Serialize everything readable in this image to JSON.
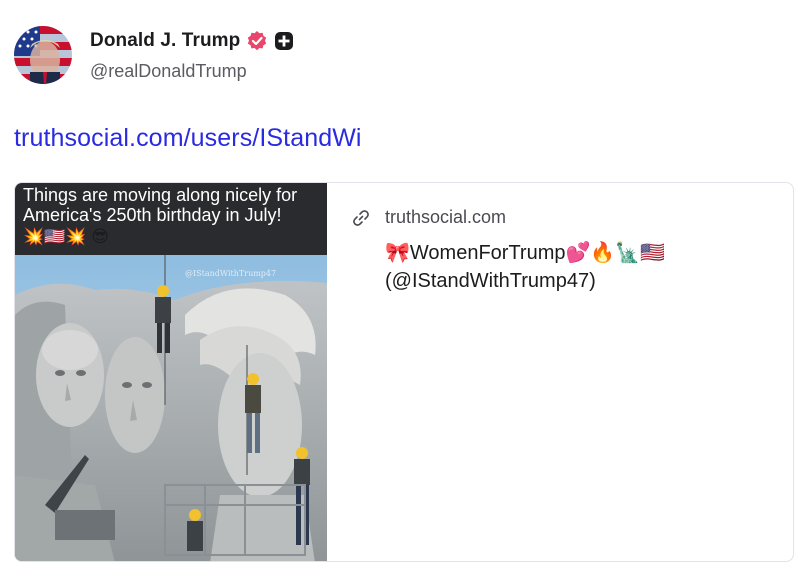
{
  "post": {
    "author": {
      "display_name": "Donald J. Trump",
      "handle": "@realDonaldTrump",
      "verified_icon": "verified-badge-icon",
      "plus_icon": "plus-badge-icon",
      "badge_color": "#e8476b"
    },
    "link_text": "truthsocial.com/users/IStandWi",
    "link_color": "#2a2ae0"
  },
  "card": {
    "thumbnail": {
      "caption": "Things are moving along nicely for America's 250th birthday in July!",
      "emoji": "💥🇺🇸💥 😎",
      "watermark": "@IStandWithTrump47"
    },
    "domain_icon": "link-icon",
    "domain": "truthsocial.com",
    "title": "🎀WomenForTrump💕🔥🗽🇺🇸 (@IStandWithTrump47)"
  }
}
